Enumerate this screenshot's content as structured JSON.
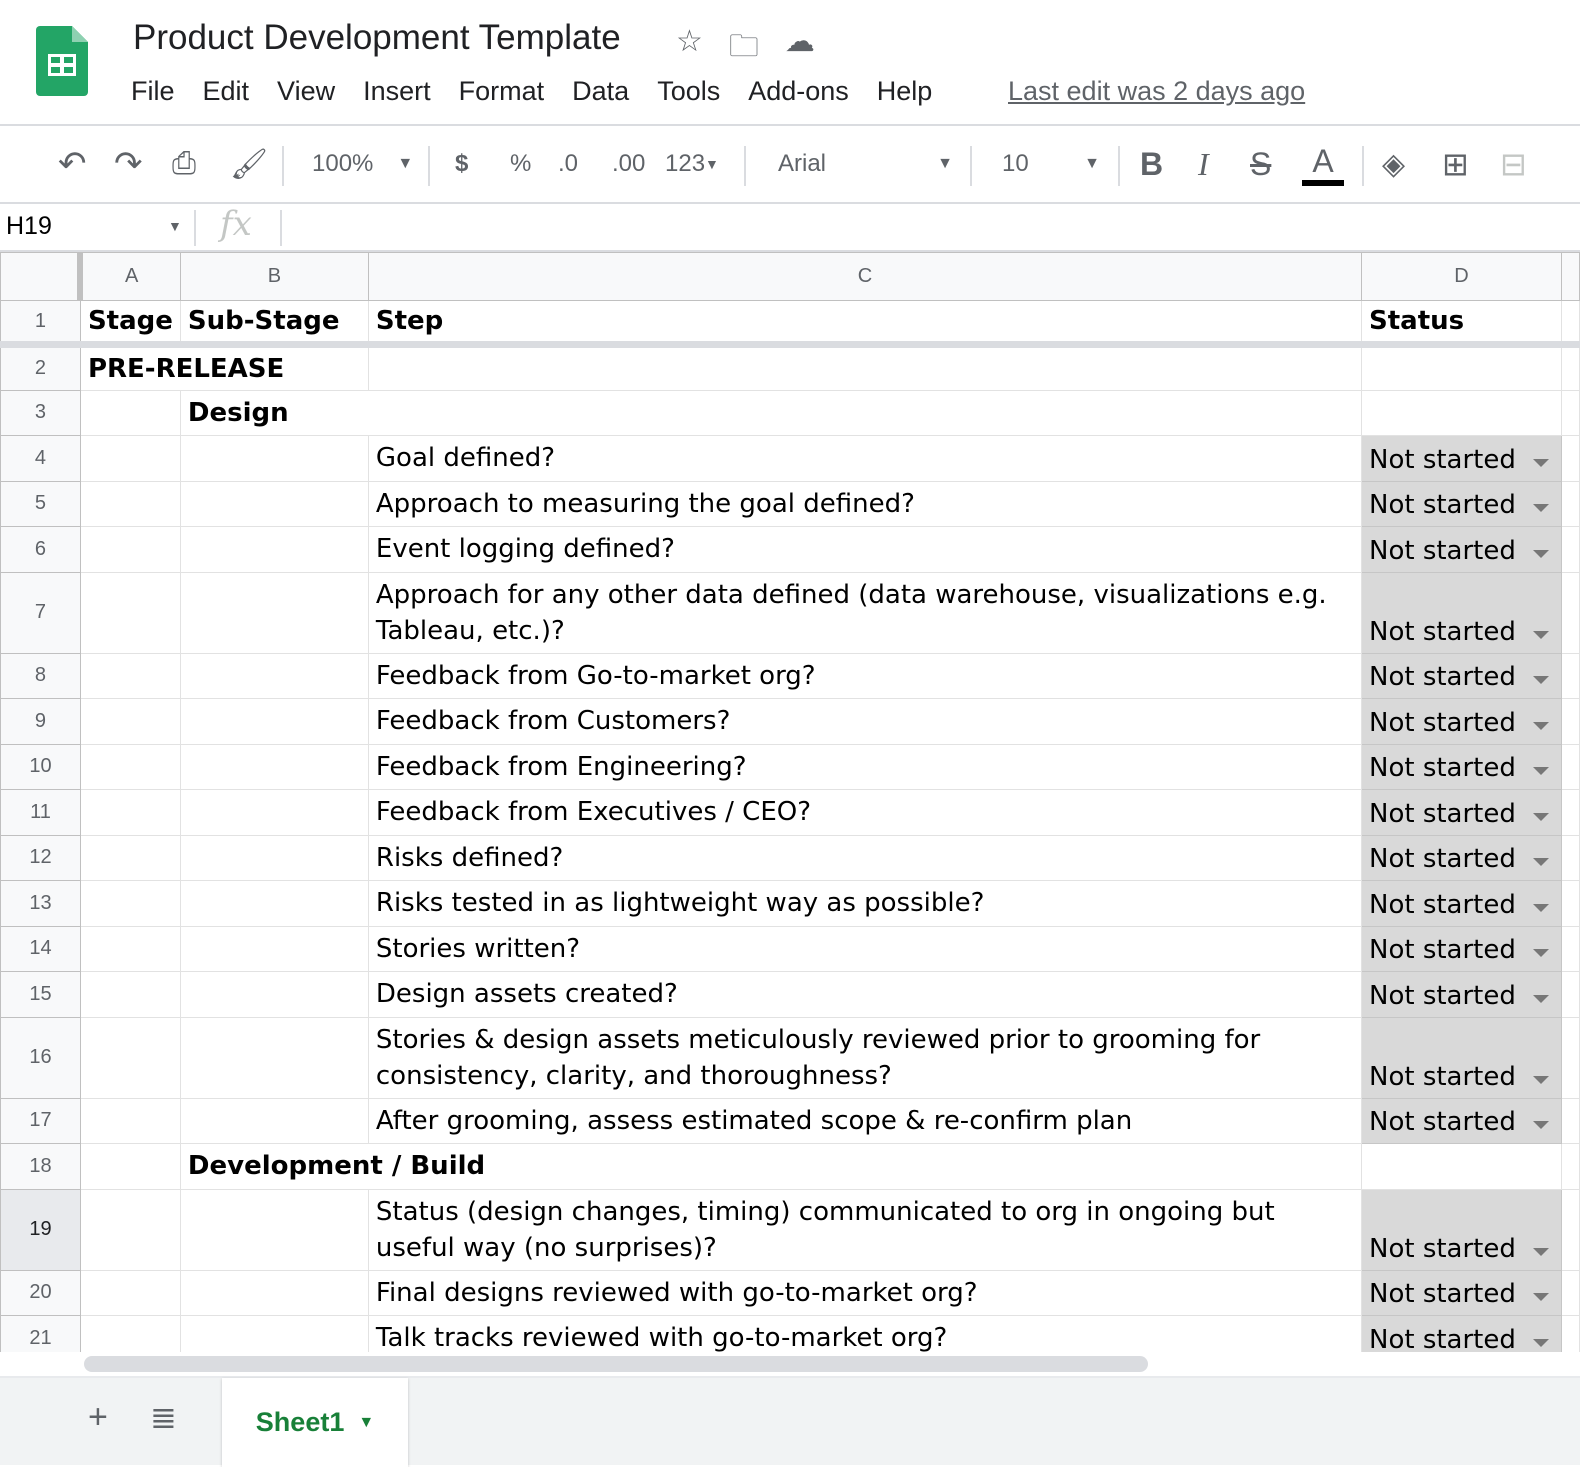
{
  "app": {
    "title": "Product Development Template",
    "last_edit": "Last edit was 2 days ago"
  },
  "menu": [
    "File",
    "Edit",
    "View",
    "Insert",
    "Format",
    "Data",
    "Tools",
    "Add-ons",
    "Help"
  ],
  "toolbar": {
    "zoom": "100%",
    "currency": "$",
    "percent": "%",
    "dec_decrease": ".0",
    "dec_increase": ".00",
    "format": "123",
    "font": "Arial",
    "font_size": "10",
    "bold": "B",
    "italic": "I",
    "strike": "S",
    "text_color": "A"
  },
  "formula_bar": {
    "cell_ref": "H19",
    "fx": "fx",
    "value": ""
  },
  "columns": [
    "A",
    "B",
    "C",
    "D"
  ],
  "rows": [
    {
      "n": "1",
      "a": "Stage",
      "b": "Sub-Stage",
      "c": "Step",
      "d": "Status",
      "header": true
    },
    {
      "n": "2",
      "a": "PRE-RELEASE",
      "b": "",
      "c": "",
      "d": ""
    },
    {
      "n": "3",
      "a": "",
      "b": "Design",
      "c": "",
      "d": ""
    },
    {
      "n": "4",
      "c": "Goal defined?",
      "d": "Not started"
    },
    {
      "n": "5",
      "c": "Approach to measuring the goal defined?",
      "d": "Not started"
    },
    {
      "n": "6",
      "c": "Event logging defined?",
      "d": "Not started"
    },
    {
      "n": "7",
      "c": "Approach for any other data defined (data warehouse, visualizations e.g. Tableau, etc.)?",
      "d": "Not started",
      "tall": true
    },
    {
      "n": "8",
      "c": "Feedback from Go-to-market org?",
      "d": "Not started"
    },
    {
      "n": "9",
      "c": "Feedback from Customers?",
      "d": "Not started"
    },
    {
      "n": "10",
      "c": "Feedback from Engineering?",
      "d": "Not started"
    },
    {
      "n": "11",
      "c": "Feedback from Executives / CEO?",
      "d": "Not started"
    },
    {
      "n": "12",
      "c": "Risks defined?",
      "d": "Not started"
    },
    {
      "n": "13",
      "c": "Risks tested in as lightweight way as possible?",
      "d": "Not started"
    },
    {
      "n": "14",
      "c": "Stories written?",
      "d": "Not started"
    },
    {
      "n": "15",
      "c": "Design assets created?",
      "d": "Not started"
    },
    {
      "n": "16",
      "c": "Stories & design assets meticulously reviewed prior to grooming for consistency, clarity, and thoroughness?",
      "d": "Not started",
      "tall": true
    },
    {
      "n": "17",
      "c": "After grooming, assess estimated scope & re-confirm plan",
      "d": "Not started"
    },
    {
      "n": "18",
      "b": "Development / Build",
      "c": "",
      "d": ""
    },
    {
      "n": "19",
      "c": "Status (design changes, timing) communicated to org in ongoing but useful way (no surprises)?",
      "d": "Not started",
      "tall": true
    },
    {
      "n": "20",
      "c": "Final designs reviewed with go-to-market org?",
      "d": "Not started"
    },
    {
      "n": "21",
      "c": "Talk tracks reviewed with go-to-market org?",
      "d": "Not started"
    }
  ],
  "sheets": {
    "active": "Sheet1",
    "add": "+"
  },
  "colors": {
    "brand": "#0f9d58",
    "tab": "#188038",
    "status_bg": "#d9d9d9"
  }
}
